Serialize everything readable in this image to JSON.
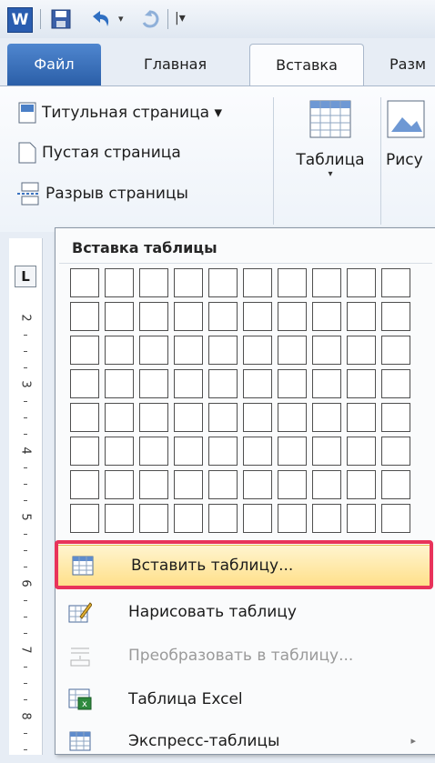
{
  "qat": {
    "word_logo": "W",
    "undo_dropdown": "▾",
    "customize": "|▾"
  },
  "tabs": {
    "file": "Файл",
    "home": "Главная",
    "insert": "Вставка",
    "layout": "Разм"
  },
  "ribbon": {
    "cover_page": "Титульная страница ▾",
    "blank_page": "Пустая страница",
    "page_break": "Разрыв страницы",
    "table": "Таблица",
    "table_arrow": "▾",
    "picture": "Рису"
  },
  "ruler": {
    "corner": "L",
    "numbers": [
      "2",
      "3",
      "4",
      "5",
      "6",
      "7",
      "8"
    ]
  },
  "menu": {
    "title": "Вставка таблицы",
    "grid": {
      "columns": 10,
      "rows": 8
    },
    "items": [
      {
        "label": "Вставить таблицу...",
        "highlighted": true,
        "enabled": true
      },
      {
        "label": "Нарисовать таблицу",
        "enabled": true
      },
      {
        "label": "Преобразовать в таблицу...",
        "enabled": false
      },
      {
        "label": "Таблица Excel",
        "enabled": true
      },
      {
        "label": "Экспресс-таблицы",
        "enabled": true,
        "submenu": "▸"
      }
    ]
  },
  "colors": {
    "file_tab": "#2b5fa8",
    "highlight": "#ffe08a",
    "callout": "#e8335a"
  }
}
